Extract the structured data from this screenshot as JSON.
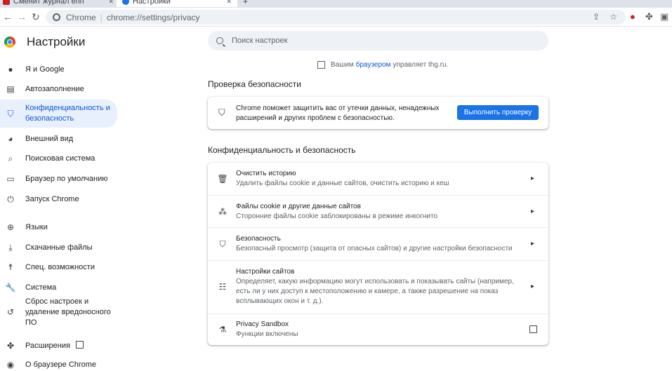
{
  "tabs": [
    {
      "label": "Сменит журнал епп",
      "color": "#c5221f"
    },
    {
      "label": "Настройки",
      "color": "#1a73e8"
    }
  ],
  "toolbar": {
    "back": "←",
    "forward": "→",
    "reload": "↻",
    "chrome_label": "Chrome",
    "separator": "|",
    "url": "chrome://settings/privacy"
  },
  "sidebar": {
    "title": "Настройки",
    "items": [
      {
        "label": "Я и Google",
        "icon": "person-icon"
      },
      {
        "label": "Автозаполнение",
        "icon": "autofill-icon"
      },
      {
        "label": "Конфиденциальность и безопасность",
        "icon": "shield-icon",
        "active": true
      },
      {
        "label": "Внешний вид",
        "icon": "palette-icon"
      },
      {
        "label": "Поисковая система",
        "icon": "search-icon"
      },
      {
        "label": "Браузер по умолчанию",
        "icon": "browser-icon"
      },
      {
        "label": "Запуск Chrome",
        "icon": "power-icon"
      },
      {
        "label": "Языки",
        "icon": "globe-icon"
      },
      {
        "label": "Скачанные файлы",
        "icon": "download-icon"
      },
      {
        "label": "Спец. возможности",
        "icon": "accessibility-icon"
      },
      {
        "label": "Система",
        "icon": "wrench-icon"
      },
      {
        "label": "Сброс настроек и удаление вредоносного ПО",
        "icon": "reset-icon"
      },
      {
        "label": "Расширения",
        "icon": "puzzle-icon"
      },
      {
        "label": "О браузере Chrome",
        "icon": "chrome-icon"
      }
    ]
  },
  "search": {
    "placeholder": "Поиск настроек"
  },
  "managed": {
    "prefix": "Вашим",
    "link": "браузером",
    "suffix": "управляет thg.ru."
  },
  "safety": {
    "section_title": "Проверка безопасности",
    "text": "Chrome поможет защитить вас от утечки данных, ненадежных расширений и других проблем с безопасностью.",
    "button": "Выполнить проверку"
  },
  "privacy": {
    "section_title": "Конфиденциальность и безопасность",
    "rows": [
      {
        "title": "Очистить историю",
        "sub": "Удалить файлы cookie и данные сайтов, очистить историю и кеш"
      },
      {
        "title": "Файлы cookie и другие данные сайтов",
        "sub": "Сторонние файлы cookie заблокированы в режиме инкогнито"
      },
      {
        "title": "Безопасность",
        "sub": "Безопасный просмотр (защита от опасных сайтов) и другие настройки безопасности"
      },
      {
        "title": "Настройки сайтов",
        "sub": "Определяет, какую информацию могут использовать и показывать сайты (например, есть ли у них доступ к местоположению и камере, а также разрешение на показ всплывающих окон и т. д.)."
      },
      {
        "title": "Privacy Sandbox",
        "sub": "Функции включены"
      }
    ]
  }
}
